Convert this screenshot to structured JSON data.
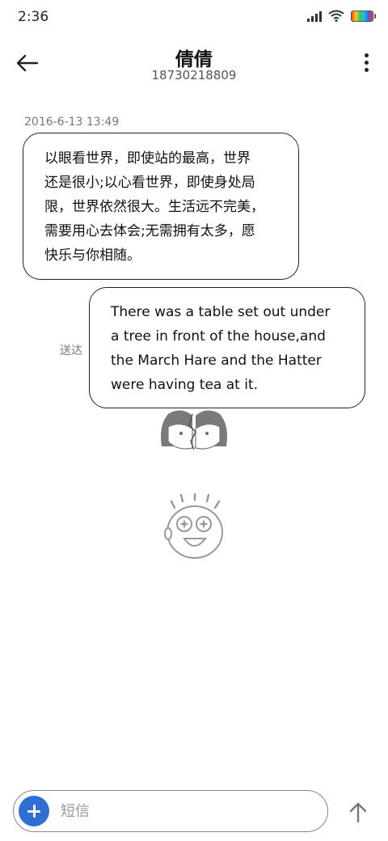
{
  "status_bar": {
    "time": "2:36",
    "icons": [
      "signal-icon",
      "wifi-icon",
      "battery-icon"
    ]
  },
  "header": {
    "contact_name": "倩倩",
    "contact_number": "18730218809",
    "back_icon": "arrow-left-icon",
    "more_icon": "more-vertical-icon"
  },
  "conversation": {
    "timestamp": "2016-6-13 13:49",
    "incoming_message": "以眼看世界，即使站的最高，世界\n还是很小;以心看世界，即使身处局\n限，世界依然很大。生活远不完美，\n需要用心去体会;无需拥有太多，愿\n快乐与你相随。",
    "outgoing_message": "There was a table set out under\na tree in front of the house,and\nthe March Hare and the Hatter\nwere having tea at it.",
    "delivery_status": "送达"
  },
  "composer": {
    "placeholder": "短信",
    "add_icon": "plus-icon",
    "send_icon": "arrow-up-icon",
    "accent_color": "#2e6fd6"
  }
}
